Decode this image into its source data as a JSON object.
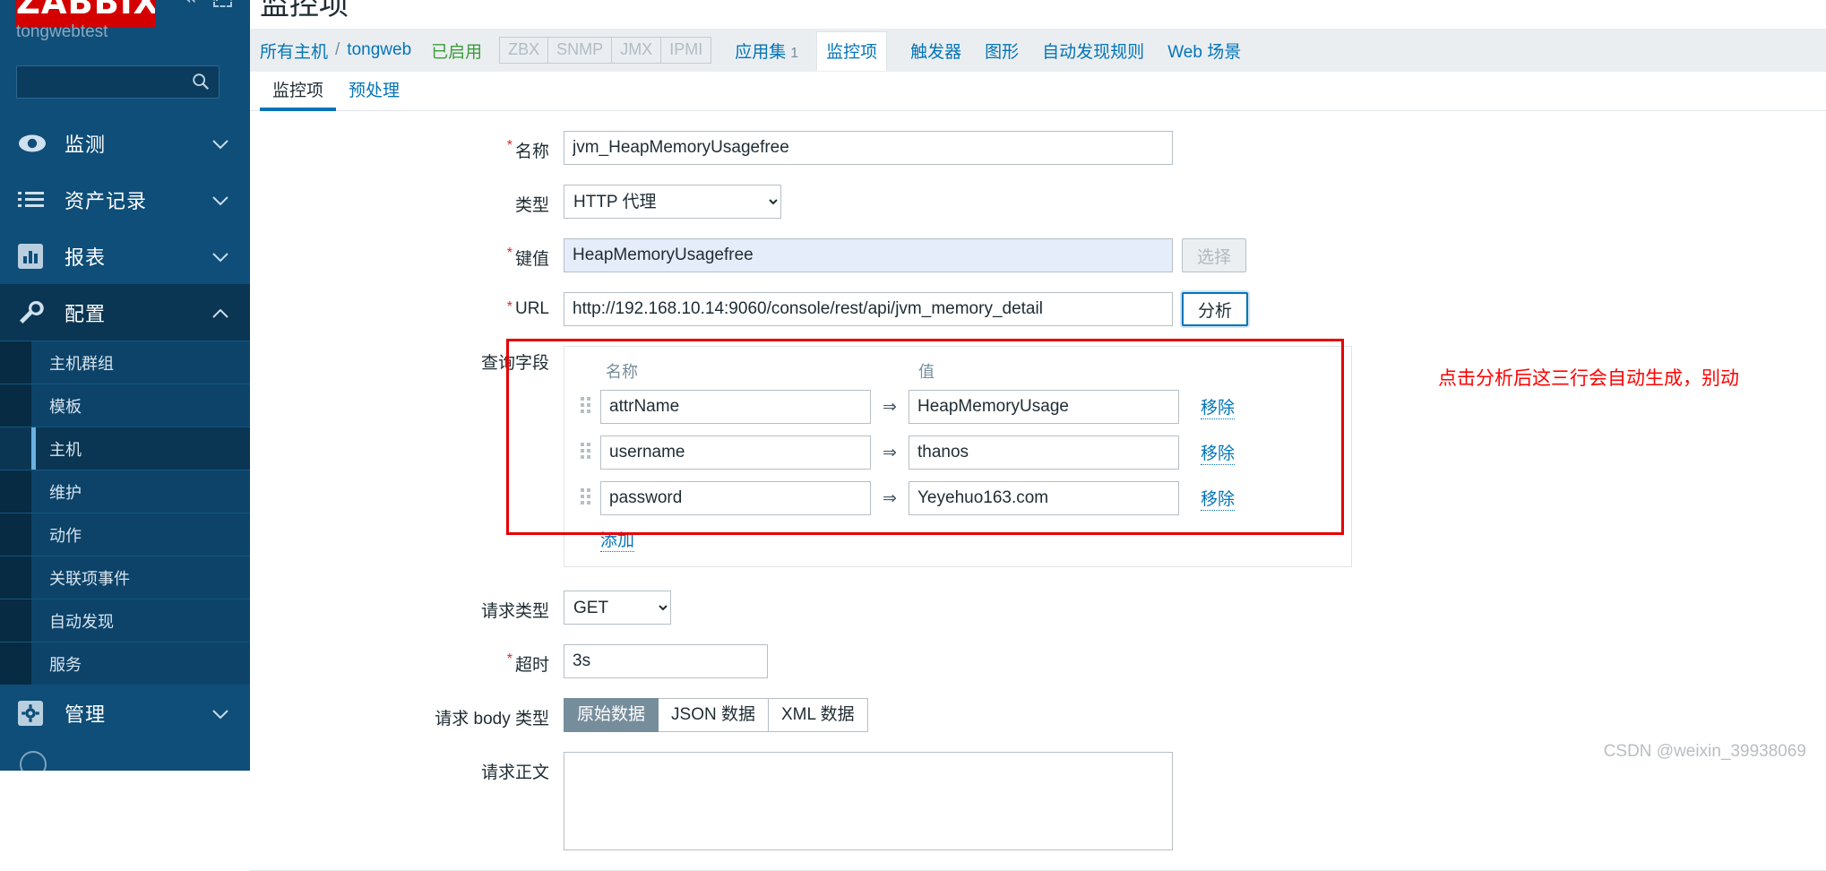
{
  "sidebar": {
    "logo": "ZABBIX",
    "server_name": "tongwebtest",
    "search_placeholder": "",
    "search_value": "",
    "nav": [
      {
        "label": "监测",
        "icon": "eye-icon"
      },
      {
        "label": "资产记录",
        "icon": "list-icon"
      },
      {
        "label": "报表",
        "icon": "chart-bar-icon"
      },
      {
        "label": "配置",
        "icon": "wrench-icon"
      },
      {
        "label": "管理",
        "icon": "gear-icon"
      }
    ],
    "config_submenu": [
      {
        "label": "主机群组"
      },
      {
        "label": "模板"
      },
      {
        "label": "主机"
      },
      {
        "label": "维护"
      },
      {
        "label": "动作"
      },
      {
        "label": "关联项事件"
      },
      {
        "label": "自动发现"
      },
      {
        "label": "服务"
      }
    ]
  },
  "header": {
    "page_title": "监控项",
    "breadcrumb": {
      "all_hosts": "所有主机",
      "separator": "/",
      "host": "tongweb",
      "status": "已启用",
      "protocols": [
        "ZBX",
        "SNMP",
        "JMX",
        "IPMI"
      ],
      "tabs": [
        {
          "label": "应用集",
          "count": "1",
          "current": false
        },
        {
          "label": "监控项",
          "count": "",
          "current": true
        },
        {
          "label": "触发器",
          "count": "",
          "current": false
        },
        {
          "label": "图形",
          "count": "",
          "current": false
        },
        {
          "label": "自动发现规则",
          "count": "",
          "current": false
        },
        {
          "label": "Web 场景",
          "count": "",
          "current": false
        }
      ]
    }
  },
  "form_tabs": [
    {
      "label": "监控项",
      "active": true
    },
    {
      "label": "预处理",
      "active": false
    }
  ],
  "form": {
    "name": {
      "label": "名称",
      "required": true,
      "value": "jvm_HeapMemoryUsagefree"
    },
    "type": {
      "label": "类型",
      "required": false,
      "value": "HTTP 代理",
      "options": [
        "HTTP 代理"
      ]
    },
    "key": {
      "label": "键值",
      "required": true,
      "value": "HeapMemoryUsagefree",
      "select_button": "选择"
    },
    "url": {
      "label": "URL",
      "required": true,
      "value": "http://192.168.10.14:9060/console/rest/api/jvm_memory_detail",
      "parse_button": "分析"
    },
    "query_fields": {
      "label": "查询字段",
      "col_name": "名称",
      "col_value": "值",
      "rows": [
        {
          "name": "attrName",
          "value": "HeapMemoryUsage",
          "remove": "移除"
        },
        {
          "name": "username",
          "value": "thanos",
          "remove": "移除"
        },
        {
          "name": "password",
          "value": "Yeyehuo163.com",
          "remove": "移除"
        }
      ],
      "add_label": "添加",
      "arrow": "⇒"
    },
    "request_type": {
      "label": "请求类型",
      "value": "GET",
      "options": [
        "GET"
      ]
    },
    "timeout": {
      "label": "超时",
      "required": true,
      "value": "3s"
    },
    "body_type": {
      "label": "请求 body 类型",
      "options": [
        {
          "label": "原始数据",
          "selected": true
        },
        {
          "label": "JSON 数据",
          "selected": false
        },
        {
          "label": "XML 数据",
          "selected": false
        }
      ]
    },
    "request_body": {
      "label": "请求正文",
      "value": ""
    }
  },
  "annotation": {
    "text": "点击分析后这三行会自动生成，别动",
    "color": "#ff0000",
    "highlight_color": "#e60000"
  },
  "watermark": "CSDN @weixin_39938069"
}
